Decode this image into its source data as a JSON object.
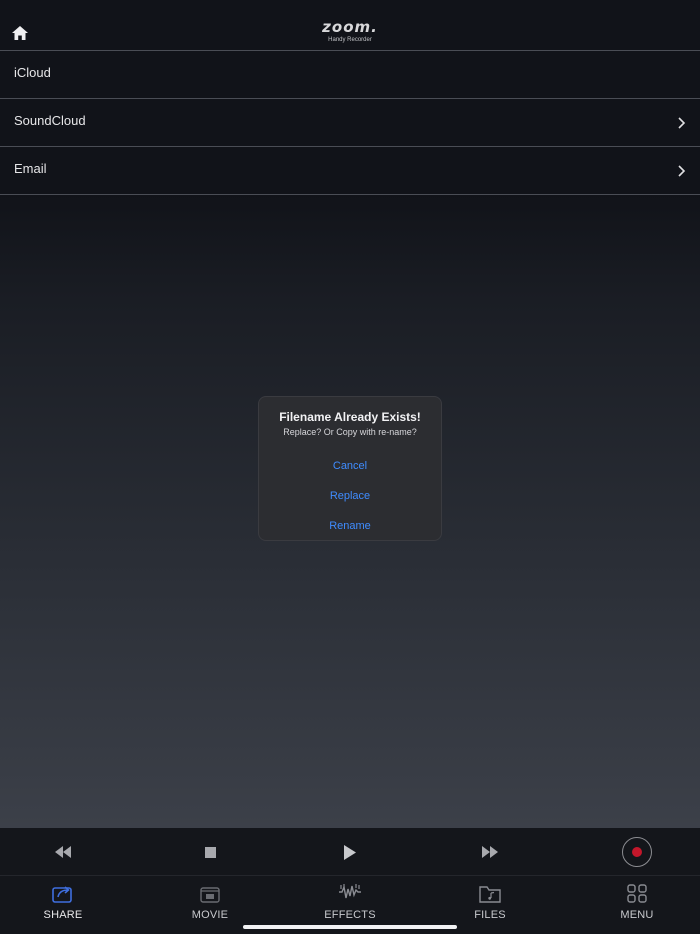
{
  "header": {
    "logo_word": "zoom.",
    "logo_subtitle": "Handy Recorder",
    "home_icon": "home-icon"
  },
  "share_list": [
    {
      "label": "iCloud",
      "has_chevron": false
    },
    {
      "label": "SoundCloud",
      "has_chevron": true
    },
    {
      "label": "Email",
      "has_chevron": true
    }
  ],
  "dialog": {
    "title": "Filename Already Exists!",
    "message": "Replace? Or Copy with re-name?",
    "cancel_label": "Cancel",
    "replace_label": "Replace",
    "rename_label": "Rename"
  },
  "transport": {
    "rewind_icon": "rewind-icon",
    "stop_icon": "stop-icon",
    "play_icon": "play-icon",
    "fast_forward_icon": "fast-forward-icon",
    "record_icon": "record-icon"
  },
  "tabs": [
    {
      "label": "SHARE",
      "icon": "share-icon",
      "active": true
    },
    {
      "label": "MOVIE",
      "icon": "movie-icon",
      "active": false
    },
    {
      "label": "EFFECTS",
      "icon": "effects-icon",
      "active": false
    },
    {
      "label": "FILES",
      "icon": "files-icon",
      "active": false
    },
    {
      "label": "MENU",
      "icon": "menu-icon",
      "active": false
    }
  ],
  "colors": {
    "background": "#111319",
    "accent_blue": "#3f8cff",
    "record_red": "#c4172b",
    "dialog_bg": "#2c2d31"
  }
}
